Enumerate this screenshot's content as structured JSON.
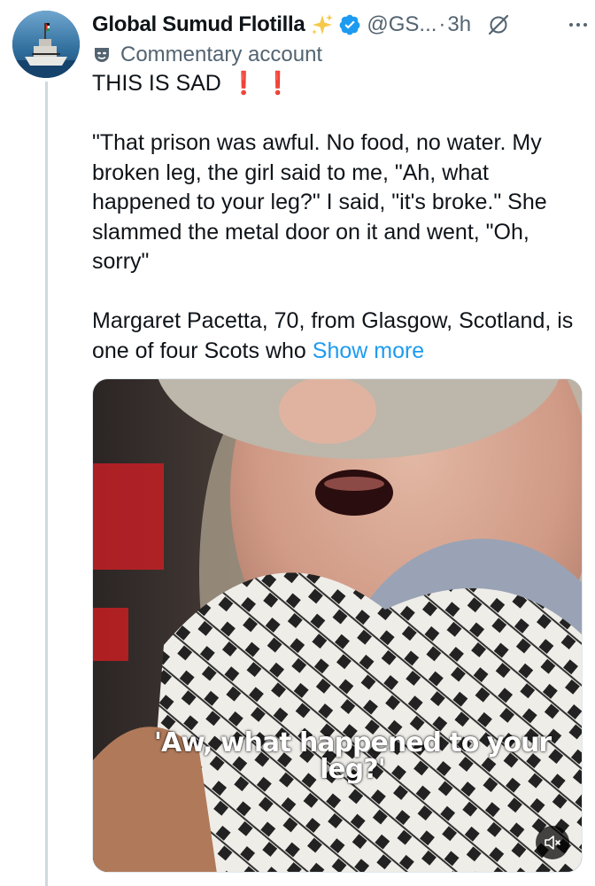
{
  "post": {
    "author_name": "Global Sumud Flotilla",
    "handle": "@GS...",
    "separator": "·",
    "time": "3h",
    "label": "Commentary account",
    "lines": [
      "THIS IS SAD",
      "\"That prison was awful. No food, no water. My broken leg, the girl said to me, \"Ah, what happened to your leg?\" I said, \"it's broke.\" She slammed the metal door on it and went, \"Oh, sorry\"",
      "Margaret Pacetta, 70, from Glasgow, Scotland, is one of four Scots who"
    ],
    "exclamations": "❗ ❗",
    "show_more": "Show more",
    "media": {
      "caption": "'Aw, what happened to your leg?'",
      "mute_icon": "speaker-muted-icon"
    }
  },
  "icons": {
    "avatar": "avatar-boat-flag",
    "badge1": "sparkle-icon",
    "badge2": "verified-icon",
    "grok": "grok-icon",
    "more": "more-options-icon",
    "mask": "theater-mask-icon"
  },
  "colors": {
    "link": "#1d9bf0",
    "muted": "#536471",
    "verified": "#1d9bf0",
    "exclamation": "#e0201a"
  }
}
